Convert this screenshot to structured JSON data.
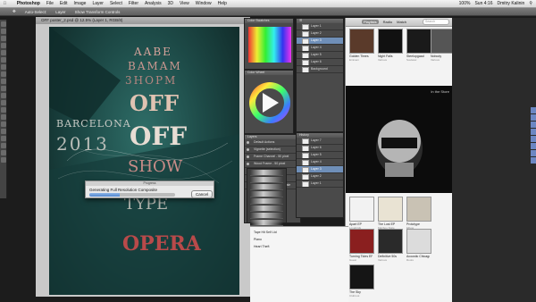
{
  "menubar": {
    "app_name": "Photoshop",
    "items": [
      "File",
      "Edit",
      "Image",
      "Layer",
      "Select",
      "Filter",
      "Analysis",
      "3D",
      "View",
      "Window",
      "Help"
    ],
    "status": [
      "100%",
      "Sun 4:16",
      "Dmitry Kalinin"
    ]
  },
  "options_bar": {
    "items": [
      "Auto-Select:",
      "Layer",
      "Show Transform Controls"
    ]
  },
  "document": {
    "tab_title": "OFF poster_2.psd @ 12.5% (Layer 1, RGB/8)"
  },
  "poster": {
    "line1": "AABE",
    "line2": "BAMAM",
    "line3": "3HOPM",
    "city": "BARCELONA",
    "year": "2013",
    "off1": "OFF",
    "off2": "OFF",
    "show": "SHOW",
    "type": "TYPE",
    "bottom": "OPERA"
  },
  "progress_dialog": {
    "title": "Progress",
    "message": "Generating Full Resolution Composite",
    "cancel_label": "Cancel",
    "progress": 0.35
  },
  "panels": {
    "color_title": "Color Swatches",
    "wheel_title": "Color Wheel",
    "layers_title": "Layers",
    "history_title": "History",
    "layers": [
      "Default Actions",
      "Vignette (selection)",
      "Frame Channel - 50 pixel",
      "Wood Frame - 50 pixel",
      "Cast Shadow (type)",
      "Water Reflection (type)",
      "Custom RGB to Grayscale"
    ],
    "mid_layers": [
      "Layer 1",
      "Layer 2",
      "Layer 3",
      "Layer 4",
      "Layer 5",
      "Layer 6",
      "Background"
    ],
    "history": [
      "Layer 7",
      "Layer 6",
      "Layer 5",
      "Layer 4",
      "Layer 3",
      "Layer 2",
      "Layer 1"
    ]
  },
  "itunes": {
    "tabs": [
      "Playlists",
      "Radio",
      "Match"
    ],
    "selected_tab": "Playlists",
    "search_placeholder": "Search",
    "albums": [
      {
        "title": "Golden Times",
        "artist": "Eminem",
        "color": "#5a3a2a"
      },
      {
        "title": "Night Falls",
        "artist": "Various",
        "color": "#111111"
      },
      {
        "title": "Steelopgaad",
        "artist": "Soulwax",
        "color": "#1a1a1a"
      },
      {
        "title": "Nobody",
        "artist": "Various",
        "color": "#555555"
      },
      {
        "title": "Apart EP",
        "artist": "Lovebirds",
        "color": "#f2f2f2"
      },
      {
        "title": "The Lost EP",
        "artist": "Maribou State",
        "color": "#e9e3d3"
      },
      {
        "title": "Prototype",
        "artist": "Elbow",
        "color": "#c9c2b4"
      },
      {
        "title": "Turning Tides EP",
        "artist": "Guest",
        "color": "#8a1f1f"
      },
      {
        "title": "Definitive 50s",
        "artist": "Various",
        "color": "#2a2a2a"
      },
      {
        "title": "Acoustic Chicago",
        "artist": "Roots",
        "color": "#dcdcdc"
      },
      {
        "title": "The Sky",
        "artist": "Clubroot",
        "color": "#151515"
      }
    ],
    "featured_label": "In the Store"
  },
  "finder": {
    "items": [
      "Tape Hit Self Ltd",
      "Piano",
      "Heart Theft"
    ]
  },
  "colors": {
    "menubar_bg": "#e6e6e6",
    "canvas_bg": "#1d4a47",
    "selection_blue": "#6f8fb8",
    "progress_blue": "#4f86cf"
  }
}
